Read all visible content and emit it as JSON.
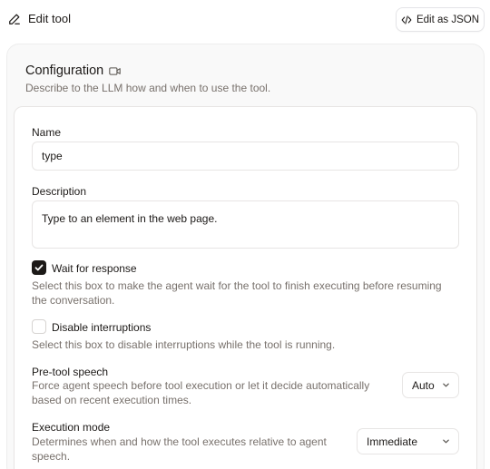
{
  "header": {
    "title": "Edit tool",
    "json_button": "Edit as JSON"
  },
  "config": {
    "title": "Configuration",
    "subtitle": "Describe to the LLM how and when to use the tool."
  },
  "form": {
    "name": {
      "label": "Name",
      "value": "type"
    },
    "description": {
      "label": "Description",
      "value": "Type to an element in the web page."
    },
    "wait_for_response": {
      "label": "Wait for response",
      "checked": true,
      "help_line1": "Select this box to make the agent wait for the tool to finish executing before resuming",
      "help_line2": "the conversation."
    },
    "disable_interruptions": {
      "label": "Disable interruptions",
      "checked": false,
      "help": "Select this box to disable interruptions while the tool is running."
    },
    "pre_tool_speech": {
      "label": "Pre-tool speech",
      "help_line1": "Force agent speech before tool execution or let it decide automatically",
      "help_line2": "based on recent execution times.",
      "selected": "Auto"
    },
    "execution_mode": {
      "label": "Execution mode",
      "help_line1": "Determines when and how the tool executes relative to agent",
      "help_line2": "speech.",
      "selected": "Immediate"
    }
  },
  "icons": {
    "edit": "pencil-icon",
    "code": "code-icon",
    "video": "video-icon",
    "check": "check-icon",
    "chevron": "chevron-down-icon"
  }
}
